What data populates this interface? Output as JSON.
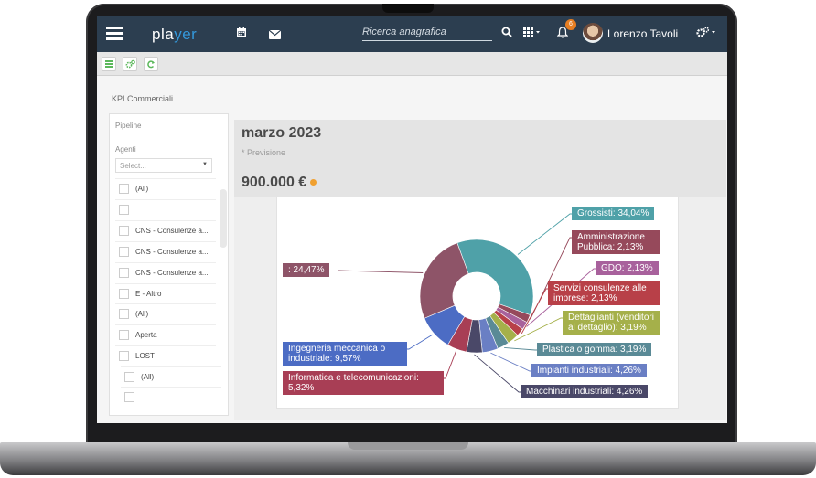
{
  "app": {
    "logo_part1": "pla",
    "logo_part2": "yer",
    "search_placeholder": "Ricerca anagrafica",
    "notifications_count": "6",
    "user_name": "Lorenzo Tavoli"
  },
  "icons": {
    "menu": "hamburger-icon",
    "calendar": "calendar-icon",
    "mail": "mail-icon",
    "search": "search-icon",
    "apps": "grid-icon",
    "bell": "bell-icon",
    "settings": "gears-icon"
  },
  "page": {
    "section_title": "KPI Commerciali"
  },
  "filters": {
    "pipeline_label": "Pipeline",
    "agents_label": "Agenti",
    "select_placeholder": "Select...",
    "agents": [
      "(All)",
      "",
      "CNS - Consulenze a...",
      "CNS - Consulenze a...",
      "CNS - Consulenze a...",
      "E - Altro"
    ],
    "status": [
      "(All)",
      "Aperta",
      "LOST"
    ],
    "extra": [
      "(All)",
      ""
    ]
  },
  "kpi": {
    "month": "marzo 2023",
    "subtitle": "* Previsione",
    "value": "900.000 €"
  },
  "chart_data": {
    "type": "pie",
    "variant": "donut",
    "slices": [
      {
        "label": "Grossisti",
        "value": 34.04,
        "display": "Grossisti: 34,04%",
        "color": "#4fa1a8"
      },
      {
        "label": "Amministrazione Pubblica",
        "value": 2.13,
        "display": "Amministrazione Pubblica: 2,13%",
        "color": "#96495b"
      },
      {
        "label": "GDO",
        "value": 2.13,
        "display": "GDO: 2,13%",
        "color": "#a8619c"
      },
      {
        "label": "Servizi consulenze alle imprese",
        "value": 2.13,
        "display": "Servizi consulenze alle imprese: 2,13%",
        "color": "#b84048"
      },
      {
        "label": "Dettaglianti (venditori al dettaglio)",
        "value": 3.19,
        "display": "Dettaglianti (venditori al dettaglio): 3,19%",
        "color": "#a5b04a"
      },
      {
        "label": "Plastica o gomma",
        "value": 3.19,
        "display": "Plastica o gomma: 3,19%",
        "color": "#5a8a96"
      },
      {
        "label": "Impianti industriali",
        "value": 4.26,
        "display": "Impianti industriali: 4,26%",
        "color": "#6a7fc4"
      },
      {
        "label": "Macchinari industriali",
        "value": 4.26,
        "display": "Macchinari industriali: 4,26%",
        "color": "#4a4868"
      },
      {
        "label": "Informatica e telecomunicazioni",
        "value": 5.32,
        "display": "Informatica e telecomunicazioni: 5,32%",
        "color": "#a83e55"
      },
      {
        "label": "Ingegneria meccanica o industriale",
        "value": 9.57,
        "display": "Ingegneria meccanica o industriale: 9,57%",
        "color": "#4c6cc4"
      },
      {
        "label": "",
        "value": 24.47,
        "display": ": 24,47%",
        "color": "#8e5468"
      }
    ]
  }
}
